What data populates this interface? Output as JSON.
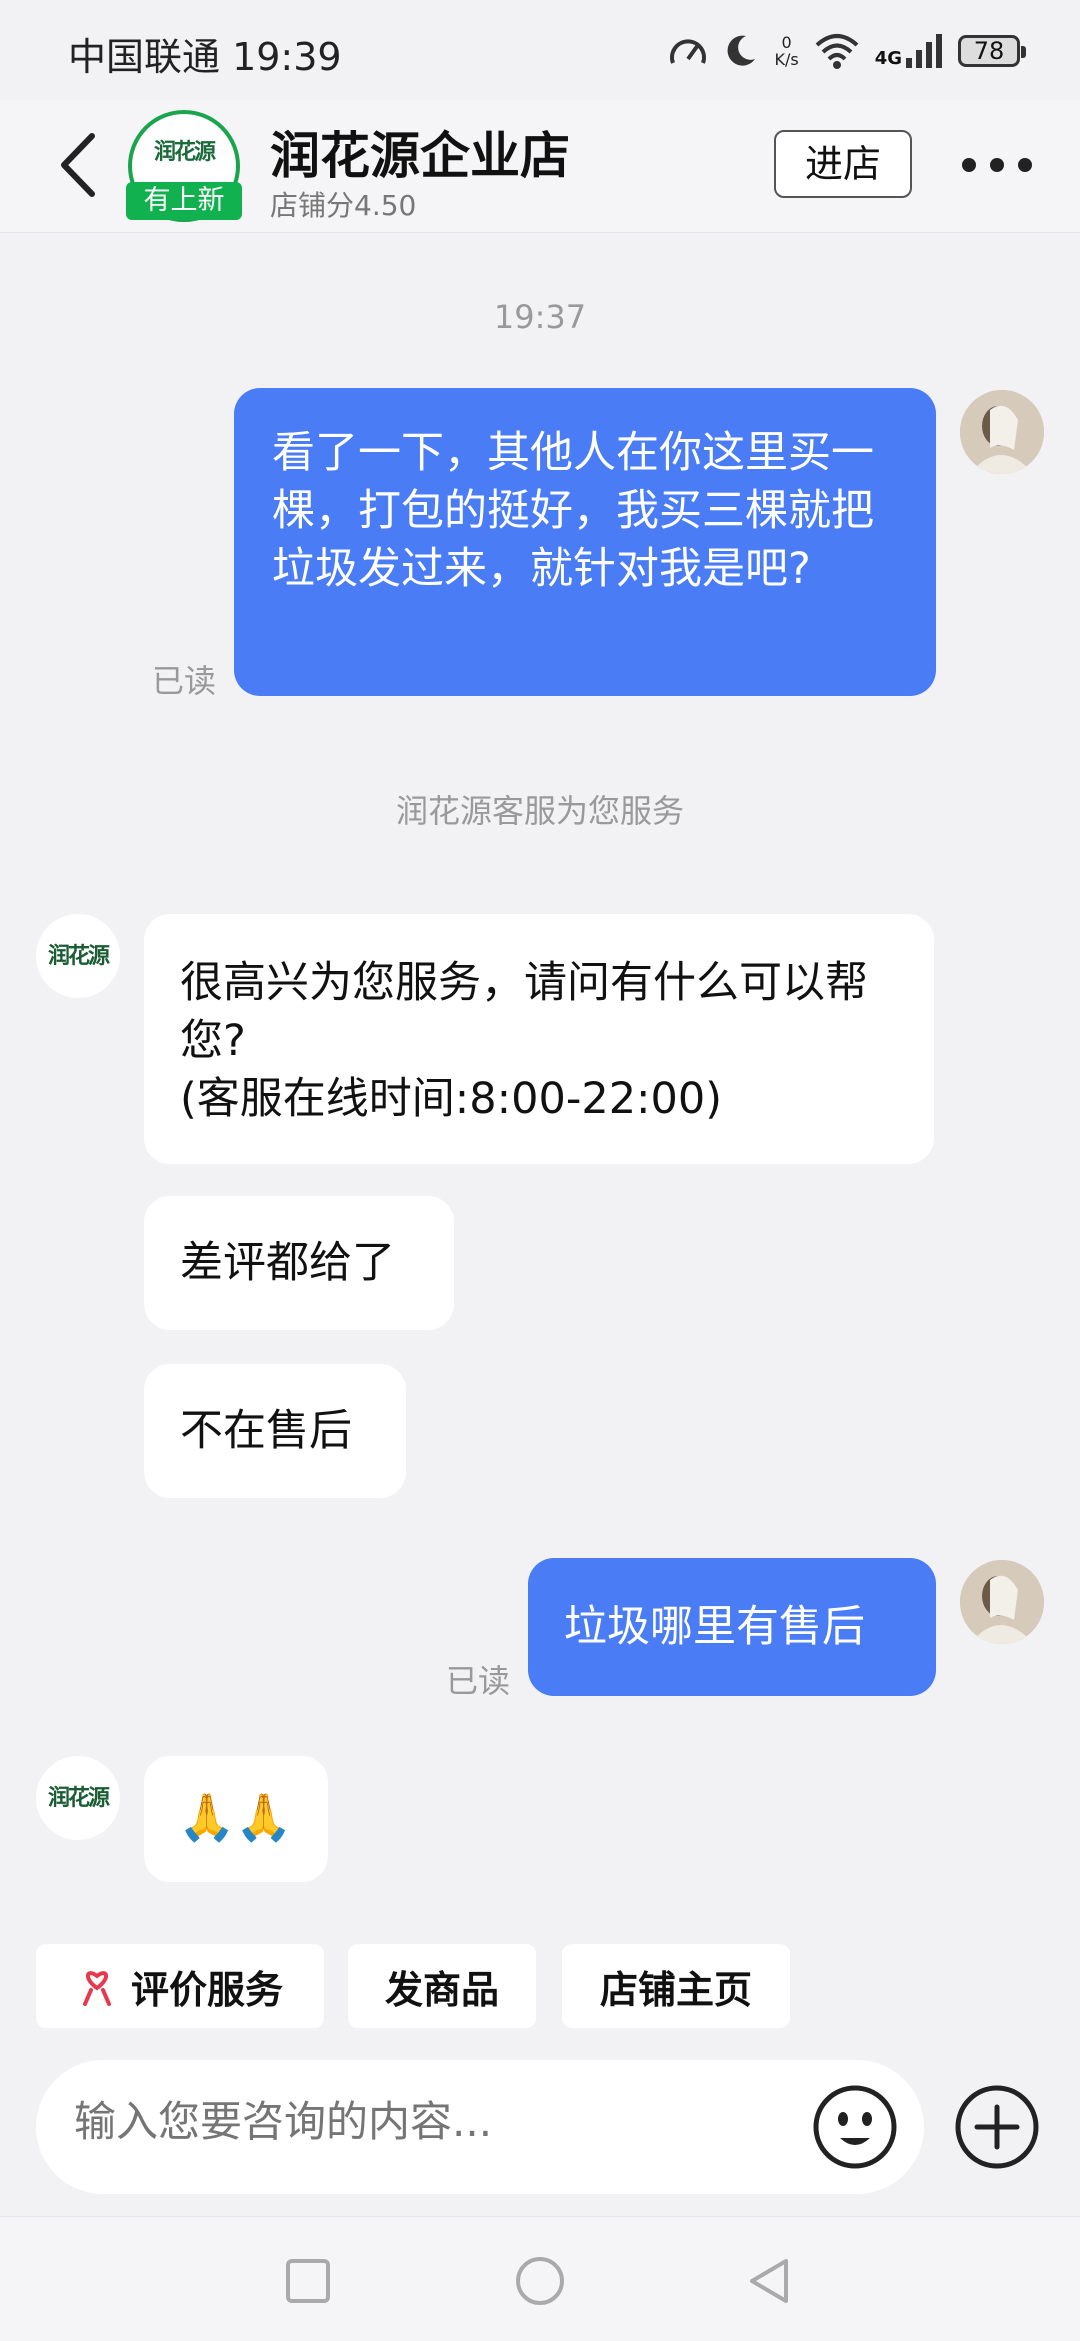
{
  "status_bar": {
    "carrier_time": "中国联通 19:39",
    "net_speed_value": "0",
    "net_speed_unit": "K/s",
    "network_type": "4G",
    "battery_level": "78"
  },
  "header": {
    "shop_name": "润花源企业店",
    "shop_score": "店铺分4.50",
    "logo_text": "润花源",
    "new_badge": "有上新",
    "enter_button": "进店"
  },
  "chat": {
    "timestamp": "19:37",
    "messages": [
      {
        "from": "me",
        "text": "看了一下，其他人在你这里买一棵，打包的挺好，我买三棵就把垃圾发过来，就针对我是吧?",
        "status": "已读"
      },
      {
        "from": "system",
        "text": "润花源客服为您服务"
      },
      {
        "from": "shop",
        "text_line1": "很高兴为您服务，请问有什么可以帮您?",
        "text_line2": "(客服在线时间:8:00-22:00)"
      },
      {
        "from": "shop",
        "text": "差评都给了"
      },
      {
        "from": "shop",
        "text": "不在售后"
      },
      {
        "from": "me",
        "text": "垃圾哪里有售后",
        "status": "已读"
      },
      {
        "from": "shop",
        "text": "🙏🙏"
      }
    ]
  },
  "quick_actions": [
    {
      "label": "评价服务",
      "icon": "heart-ribbon-icon"
    },
    {
      "label": "发商品"
    },
    {
      "label": "店铺主页"
    }
  ],
  "input": {
    "placeholder": "输入您要咨询的内容..."
  },
  "colors": {
    "my_bubble": "#4a7cf6",
    "badge_green": "#12b14f",
    "rate_icon_red": "#e8384d"
  }
}
